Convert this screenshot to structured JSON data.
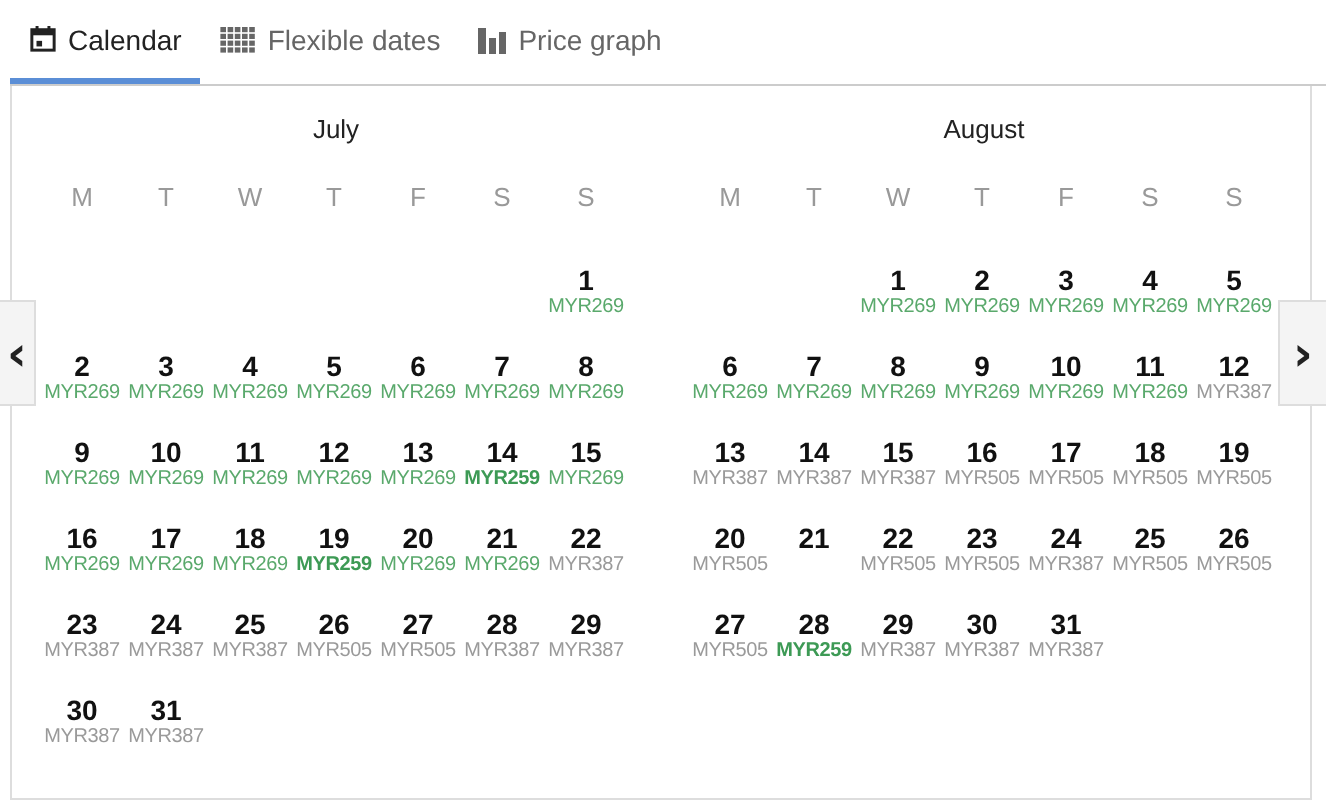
{
  "tabs": [
    {
      "label": "Calendar",
      "kind": "calendar",
      "selected": true
    },
    {
      "label": "Flexible dates",
      "kind": "grid",
      "selected": false
    },
    {
      "label": "Price graph",
      "kind": "bars",
      "selected": false
    }
  ],
  "nav": {
    "prev": "‹",
    "next": "›"
  },
  "months": [
    {
      "name": "July",
      "weekdays": [
        "M",
        "T",
        "W",
        "T",
        "F",
        "S",
        "S"
      ],
      "weeks": [
        [
          {
            "day": "1",
            "price": "MYR269",
            "kind": "low"
          }
        ],
        [
          {
            "day": "2",
            "price": "MYR269",
            "kind": "low"
          },
          {
            "day": "3",
            "price": "MYR269",
            "kind": "low"
          },
          {
            "day": "4",
            "price": "MYR269",
            "kind": "low"
          },
          {
            "day": "5",
            "price": "MYR269",
            "kind": "low"
          },
          {
            "day": "6",
            "price": "MYR269",
            "kind": "low"
          },
          {
            "day": "7",
            "price": "MYR269",
            "kind": "low"
          },
          {
            "day": "8",
            "price": "MYR269",
            "kind": "low"
          }
        ],
        [
          {
            "day": "9",
            "price": "MYR269",
            "kind": "low"
          },
          {
            "day": "10",
            "price": "MYR269",
            "kind": "low"
          },
          {
            "day": "11",
            "price": "MYR269",
            "kind": "low"
          },
          {
            "day": "12",
            "price": "MYR269",
            "kind": "low"
          },
          {
            "day": "13",
            "price": "MYR269",
            "kind": "low"
          },
          {
            "day": "14",
            "price": "MYR259",
            "kind": "lowest"
          },
          {
            "day": "15",
            "price": "MYR269",
            "kind": "low"
          }
        ],
        [
          {
            "day": "16",
            "price": "MYR269",
            "kind": "low"
          },
          {
            "day": "17",
            "price": "MYR269",
            "kind": "low"
          },
          {
            "day": "18",
            "price": "MYR269",
            "kind": "low"
          },
          {
            "day": "19",
            "price": "MYR259",
            "kind": "lowest"
          },
          {
            "day": "20",
            "price": "MYR269",
            "kind": "low"
          },
          {
            "day": "21",
            "price": "MYR269",
            "kind": "low"
          },
          {
            "day": "22",
            "price": "MYR387",
            "kind": "regular"
          }
        ],
        [
          {
            "day": "23",
            "price": "MYR387",
            "kind": "regular"
          },
          {
            "day": "24",
            "price": "MYR387",
            "kind": "regular"
          },
          {
            "day": "25",
            "price": "MYR387",
            "kind": "regular"
          },
          {
            "day": "26",
            "price": "MYR505",
            "kind": "regular"
          },
          {
            "day": "27",
            "price": "MYR505",
            "kind": "regular"
          },
          {
            "day": "28",
            "price": "MYR387",
            "kind": "regular"
          },
          {
            "day": "29",
            "price": "MYR387",
            "kind": "regular"
          }
        ],
        [
          {
            "day": "30",
            "price": "MYR387",
            "kind": "regular"
          },
          {
            "day": "31",
            "price": "MYR387",
            "kind": "regular"
          }
        ]
      ]
    },
    {
      "name": "August",
      "weekdays": [
        "M",
        "T",
        "W",
        "T",
        "F",
        "S",
        "S"
      ],
      "weeks": [
        [
          {
            "day": "1",
            "price": "MYR269",
            "kind": "low"
          },
          {
            "day": "2",
            "price": "MYR269",
            "kind": "low"
          },
          {
            "day": "3",
            "price": "MYR269",
            "kind": "low"
          },
          {
            "day": "4",
            "price": "MYR269",
            "kind": "low"
          },
          {
            "day": "5",
            "price": "MYR269",
            "kind": "low"
          }
        ],
        [
          {
            "day": "6",
            "price": "MYR269",
            "kind": "low"
          },
          {
            "day": "7",
            "price": "MYR269",
            "kind": "low"
          },
          {
            "day": "8",
            "price": "MYR269",
            "kind": "low"
          },
          {
            "day": "9",
            "price": "MYR269",
            "kind": "low"
          },
          {
            "day": "10",
            "price": "MYR269",
            "kind": "low"
          },
          {
            "day": "11",
            "price": "MYR269",
            "kind": "low"
          },
          {
            "day": "12",
            "price": "MYR387",
            "kind": "regular"
          }
        ],
        [
          {
            "day": "13",
            "price": "MYR387",
            "kind": "regular"
          },
          {
            "day": "14",
            "price": "MYR387",
            "kind": "regular"
          },
          {
            "day": "15",
            "price": "MYR387",
            "kind": "regular"
          },
          {
            "day": "16",
            "price": "MYR505",
            "kind": "regular"
          },
          {
            "day": "17",
            "price": "MYR505",
            "kind": "regular"
          },
          {
            "day": "18",
            "price": "MYR505",
            "kind": "regular"
          },
          {
            "day": "19",
            "price": "MYR505",
            "kind": "regular"
          }
        ],
        [
          {
            "day": "20",
            "price": "MYR505",
            "kind": "regular"
          },
          {
            "day": "21"
          },
          {
            "day": "22",
            "price": "MYR505",
            "kind": "regular"
          },
          {
            "day": "23",
            "price": "MYR505",
            "kind": "regular"
          },
          {
            "day": "24",
            "price": "MYR387",
            "kind": "regular"
          },
          {
            "day": "25",
            "price": "MYR505",
            "kind": "regular"
          },
          {
            "day": "26",
            "price": "MYR505",
            "kind": "regular"
          }
        ],
        [
          {
            "day": "27",
            "price": "MYR505",
            "kind": "regular"
          },
          {
            "day": "28",
            "price": "MYR259",
            "kind": "lowest"
          },
          {
            "day": "29",
            "price": "MYR387",
            "kind": "regular"
          },
          {
            "day": "30",
            "price": "MYR387",
            "kind": "regular"
          },
          {
            "day": "31",
            "price": "MYR387",
            "kind": "regular"
          }
        ]
      ]
    }
  ]
}
